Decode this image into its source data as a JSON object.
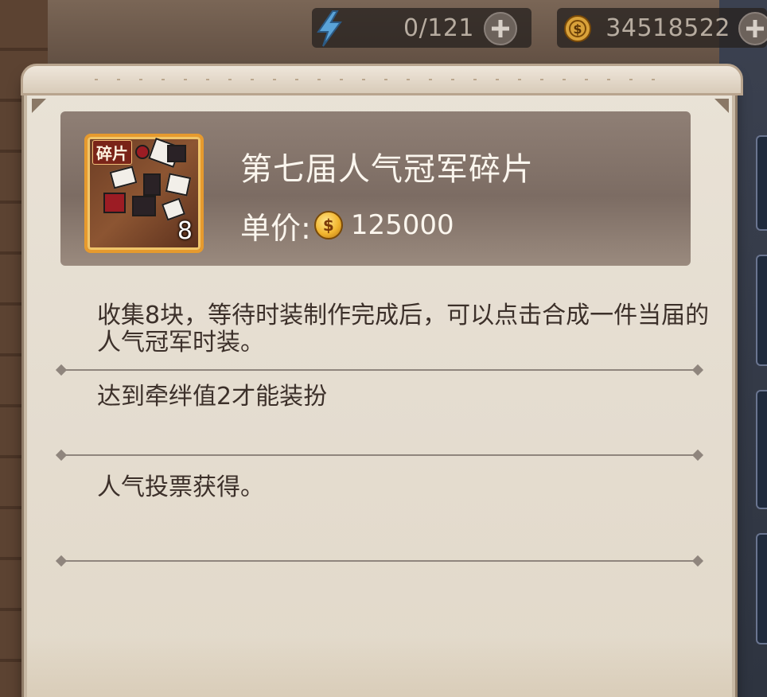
{
  "resources": {
    "energy": {
      "icon": "lightning-icon",
      "value": "0/121"
    },
    "coins": {
      "icon": "coin-icon",
      "value": "34518522"
    }
  },
  "item": {
    "icon_tag": "碎片",
    "count": "8",
    "name": "第七届人气冠军碎片",
    "price_label": "单价:",
    "price_icon": "coin-icon",
    "price_value": "125000"
  },
  "sections": {
    "description": "收集8块，等待时装制作完成后，可以点击合成一件当届的人气冠军时装。",
    "requirement": "达到牵绊值2才能装扮",
    "source": "人气投票获得。"
  },
  "colors": {
    "panel_bg": "#e6dfd3",
    "header_card": "#857469",
    "accent_gold": "#e69a2e",
    "text_dark": "#3c302a"
  }
}
